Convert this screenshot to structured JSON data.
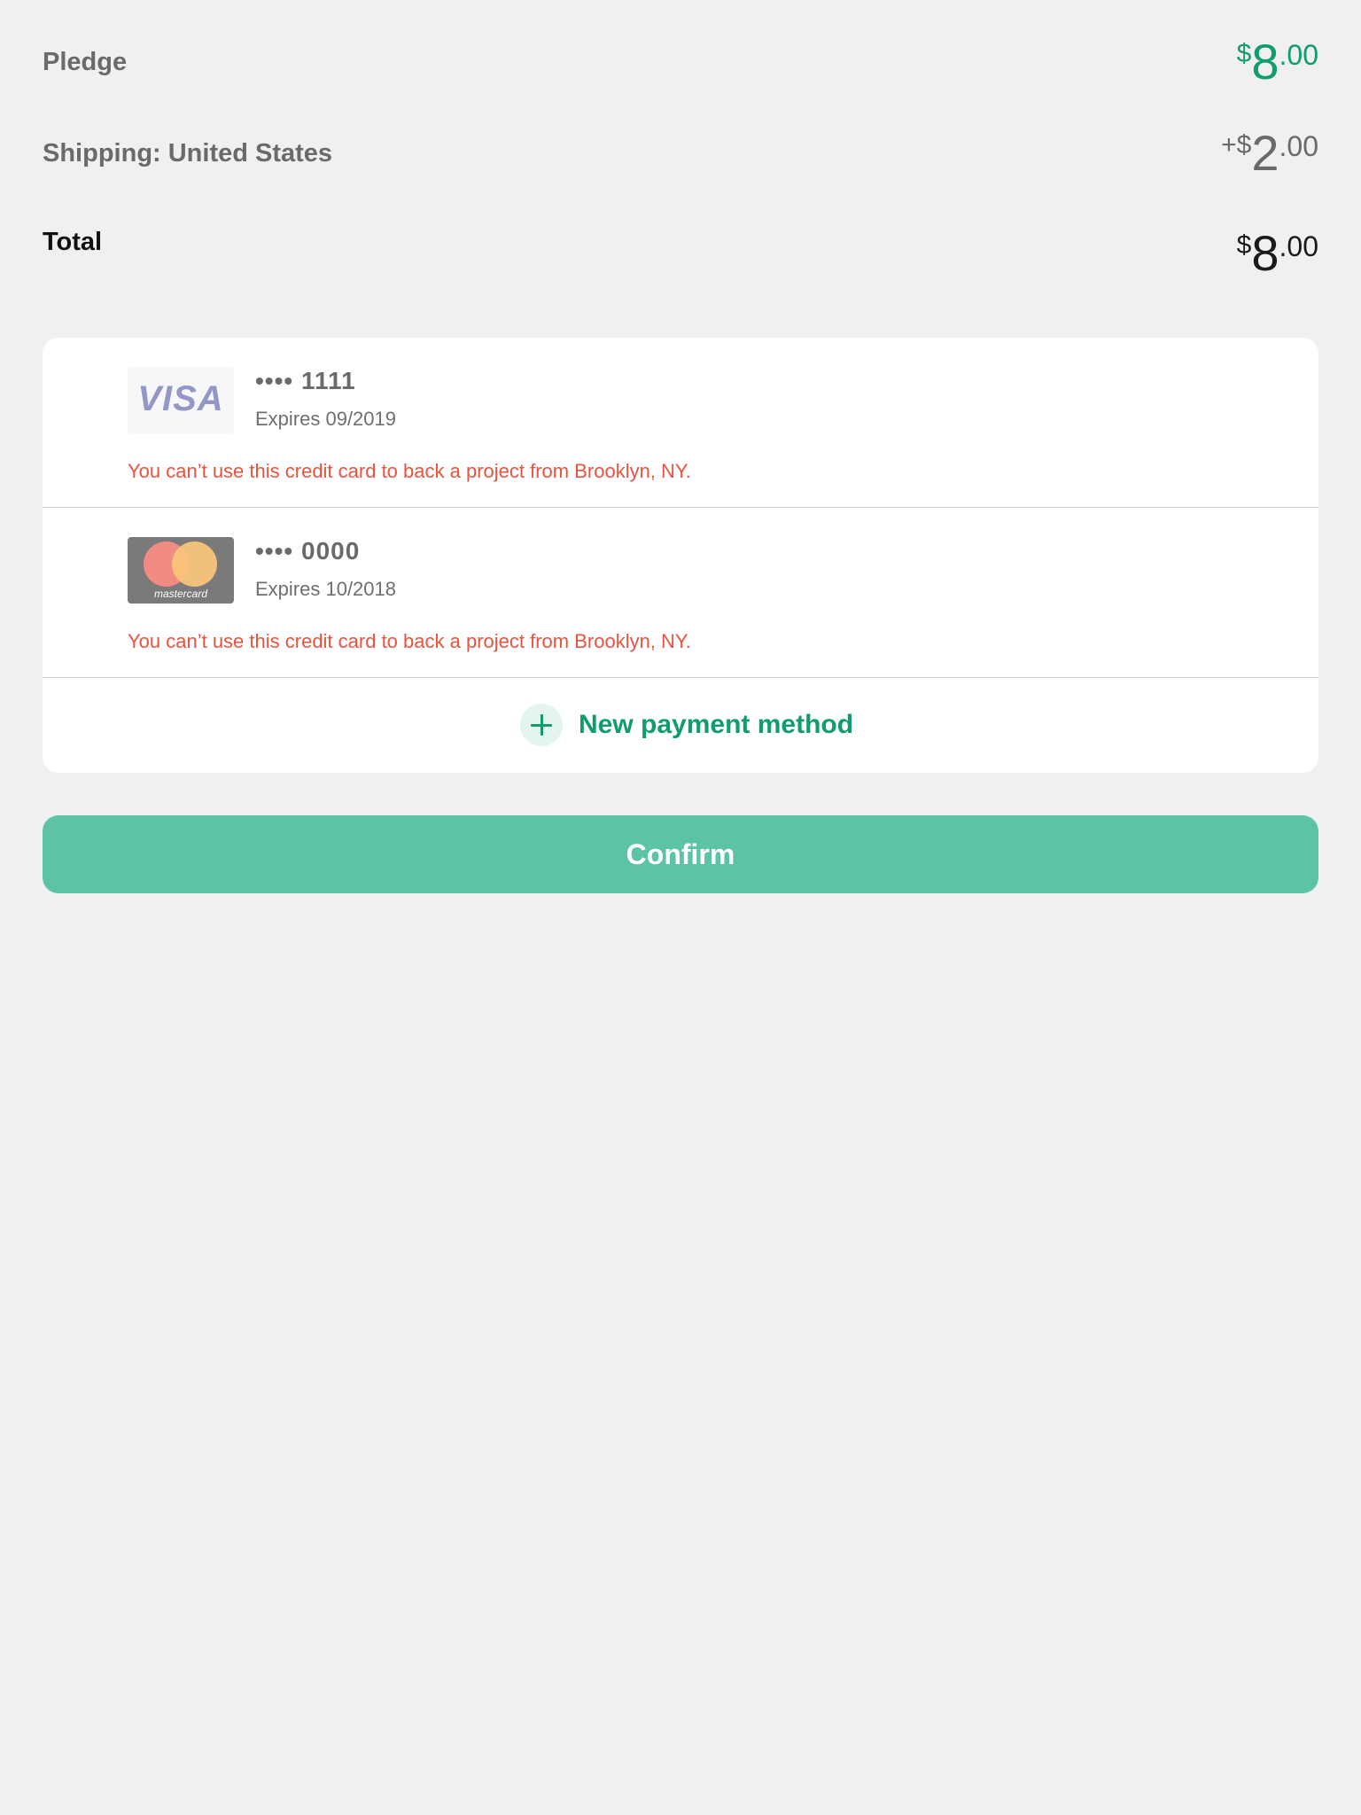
{
  "summary": {
    "pledge": {
      "label": "Pledge",
      "currency": "$",
      "major": "8",
      "minor": ".00",
      "color": "#0f9d6e"
    },
    "shipping": {
      "label": "Shipping: United States",
      "prefix": "+",
      "currency": "$",
      "major": "2",
      "minor": ".00",
      "color": "#6a6a6a"
    },
    "total": {
      "label": "Total",
      "currency": "$",
      "major": "8",
      "minor": ".00",
      "color": "#1a1a1a"
    }
  },
  "payment_methods": [
    {
      "brand": "visa",
      "brand_text": "VISA",
      "number": "•••• 1111",
      "expiry": "Expires 09/2019",
      "error": "You can’t use this credit card to back a project from Brooklyn, NY."
    },
    {
      "brand": "mastercard",
      "brand_text": "mastercard",
      "number": "•••• 0000",
      "expiry": "Expires 10/2018",
      "error": "You can’t use this credit card to back a project from Brooklyn, NY."
    }
  ],
  "new_method": {
    "label": "New payment method",
    "icon": "plus-icon"
  },
  "confirm": {
    "label": "Confirm"
  },
  "colors": {
    "accent": "#0f9d6e",
    "error": "#e8533f",
    "confirm_bg": "#5cc3a7",
    "background": "#f0f0f0"
  }
}
